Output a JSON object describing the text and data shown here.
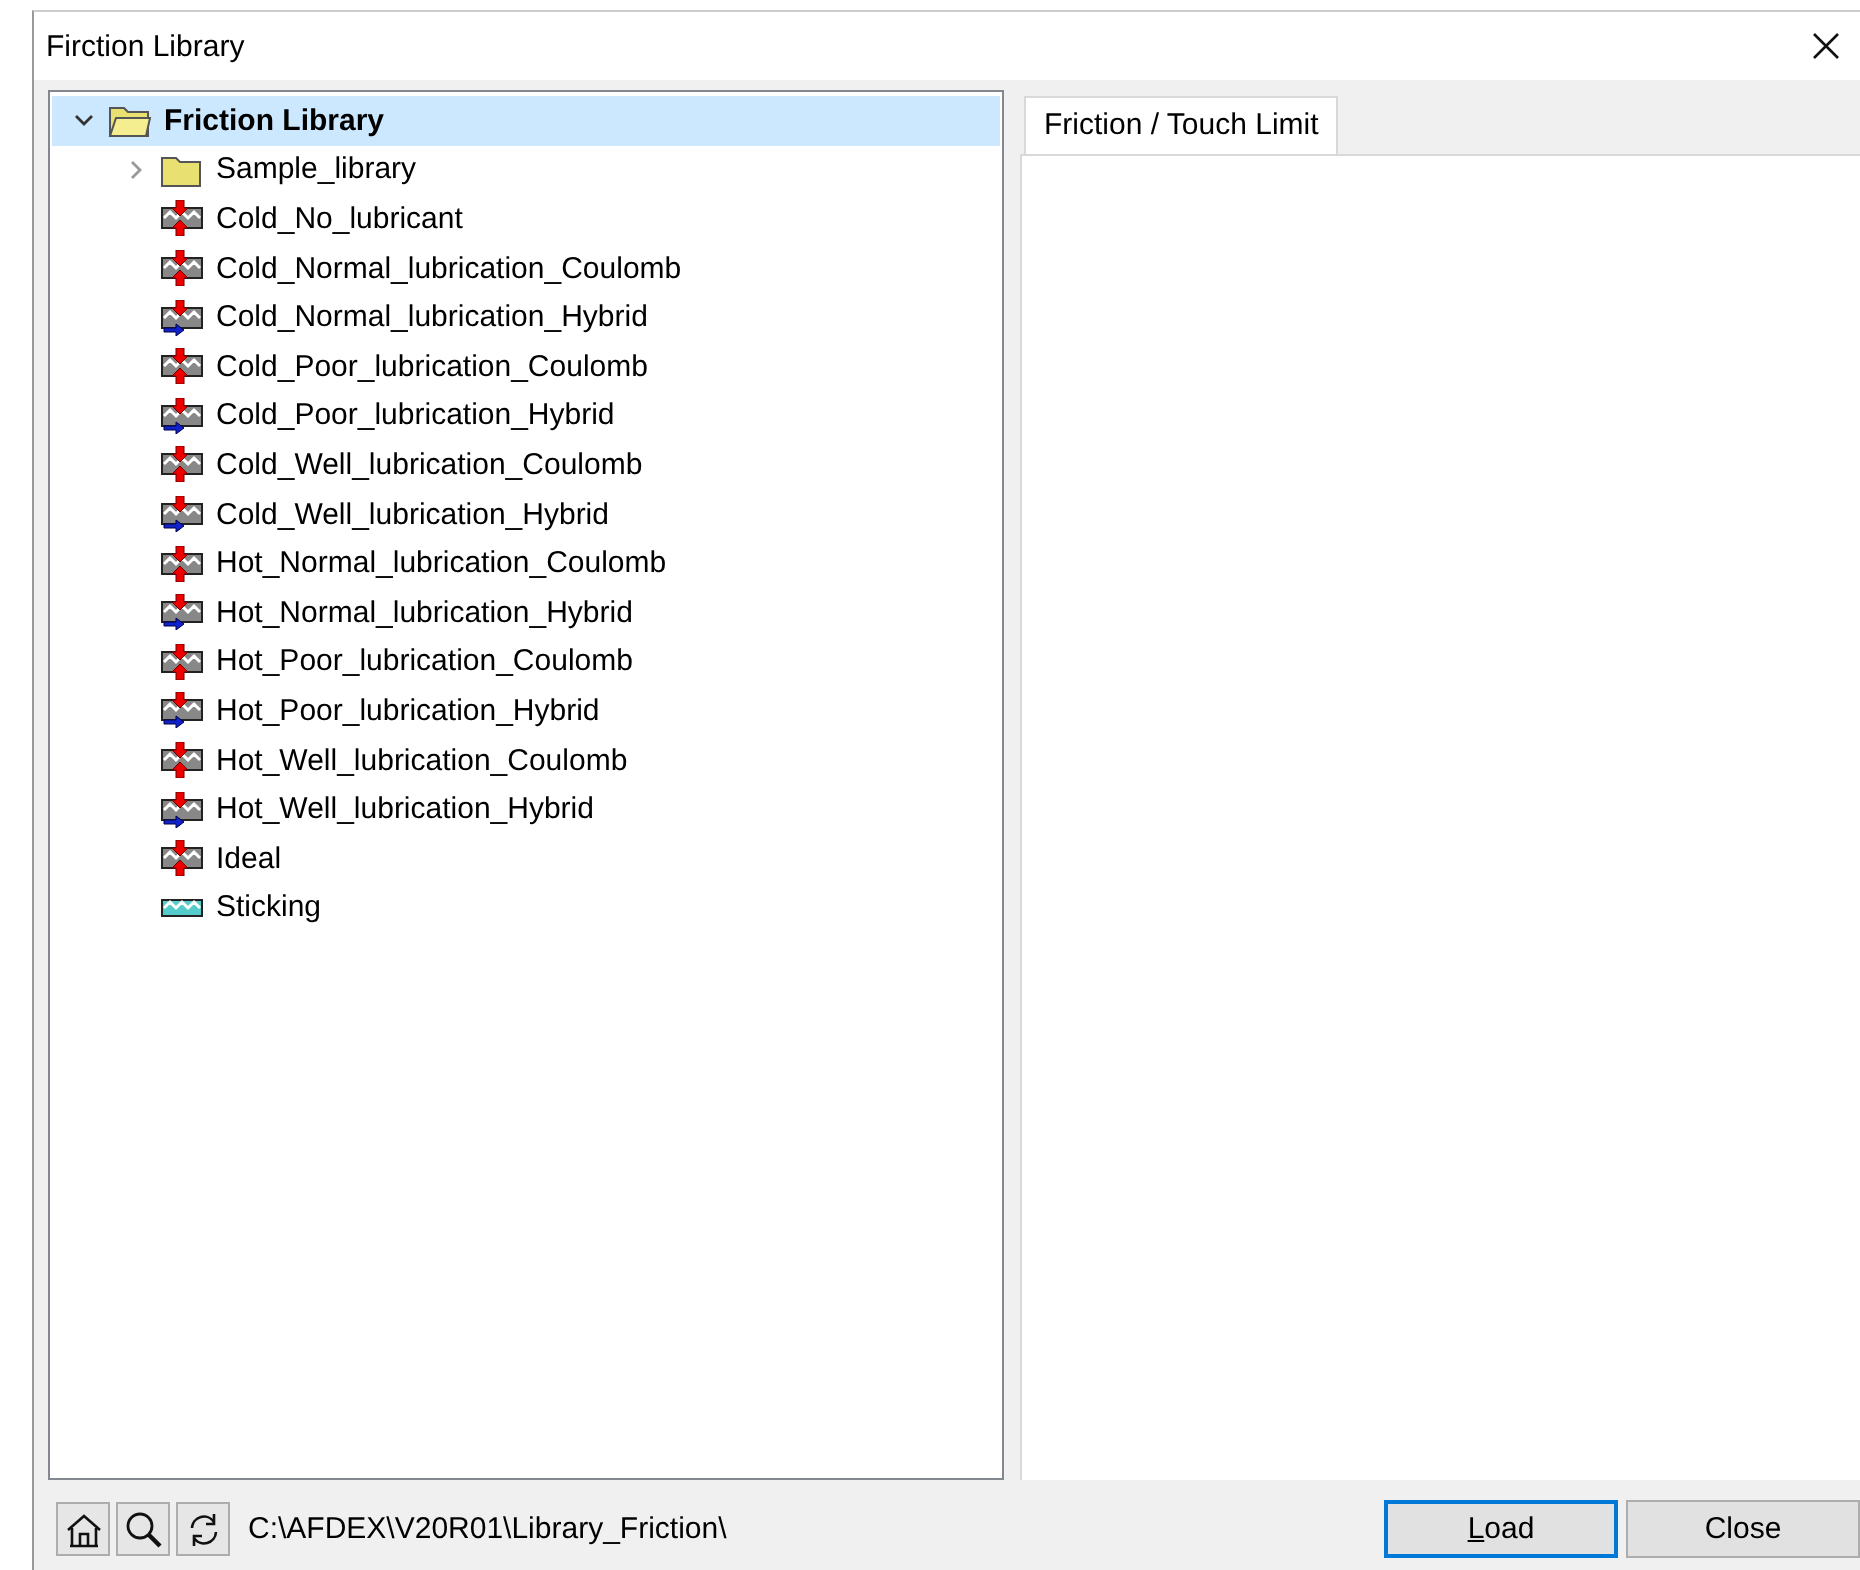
{
  "window": {
    "title": "Firction Library"
  },
  "tree": [
    {
      "label": "Friction Library",
      "kind": "folder",
      "expanded": true,
      "selected": true,
      "children": [
        {
          "label": "Sample_library",
          "kind": "folder",
          "expanded": false,
          "selected": false
        },
        {
          "label": "Cold_No_lubricant",
          "kind": "coulomb",
          "selected": false
        },
        {
          "label": "Cold_Normal_lubrication_Coulomb",
          "kind": "coulomb",
          "selected": false
        },
        {
          "label": "Cold_Normal_lubrication_Hybrid",
          "kind": "hybrid",
          "selected": false
        },
        {
          "label": "Cold_Poor_lubrication_Coulomb",
          "kind": "coulomb",
          "selected": false
        },
        {
          "label": "Cold_Poor_lubrication_Hybrid",
          "kind": "hybrid",
          "selected": false
        },
        {
          "label": "Cold_Well_lubrication_Coulomb",
          "kind": "coulomb",
          "selected": false
        },
        {
          "label": "Cold_Well_lubrication_Hybrid",
          "kind": "hybrid",
          "selected": false
        },
        {
          "label": "Hot_Normal_lubrication_Coulomb",
          "kind": "coulomb",
          "selected": false
        },
        {
          "label": "Hot_Normal_lubrication_Hybrid",
          "kind": "hybrid",
          "selected": false
        },
        {
          "label": "Hot_Poor_lubrication_Coulomb",
          "kind": "coulomb",
          "selected": false
        },
        {
          "label": "Hot_Poor_lubrication_Hybrid",
          "kind": "hybrid",
          "selected": false
        },
        {
          "label": "Hot_Well_lubrication_Coulomb",
          "kind": "coulomb",
          "selected": false
        },
        {
          "label": "Hot_Well_lubrication_Hybrid",
          "kind": "hybrid",
          "selected": false
        },
        {
          "label": "Ideal",
          "kind": "coulomb",
          "selected": false
        },
        {
          "label": "Sticking",
          "kind": "sticking",
          "selected": false
        }
      ]
    }
  ],
  "tabs": [
    {
      "label": "Friction / Touch Limit",
      "selected": true
    }
  ],
  "path": "C:\\AFDEX\\V20R01\\Library_Friction\\",
  "buttons": [
    {
      "label": "Load",
      "default": true
    },
    {
      "label": "Close",
      "default": false
    }
  ]
}
